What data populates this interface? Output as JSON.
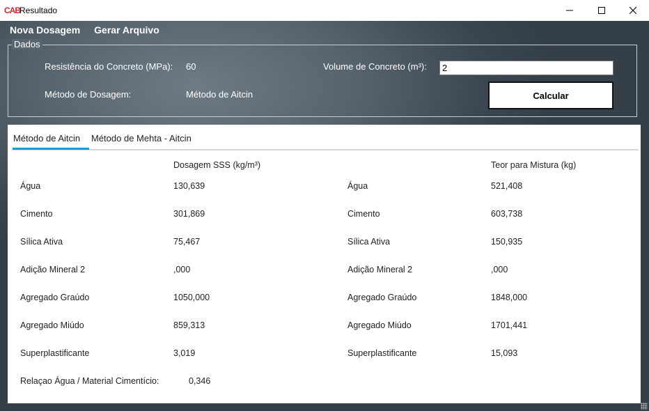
{
  "window": {
    "app_icon_text": "CAB",
    "title": "Resultado"
  },
  "menu": {
    "items": [
      "Nova Dosagem",
      "Gerar Arquivo"
    ]
  },
  "dados": {
    "legend": "Dados",
    "resistencia_label": "Resistência do Concreto (MPa):",
    "resistencia_value": "60",
    "metodo_label": "Método de Dosagem:",
    "metodo_value": "Método de Aitcin",
    "volume_label": "Volume de Concreto (m³):",
    "volume_value": "2",
    "calcular_label": "Calcular"
  },
  "tabs": [
    "Método de Aitcin",
    "Método de Mehta - Aitcin"
  ],
  "results": {
    "col1_header": "Dosagem SSS (kg/m³)",
    "col2_header": "Teor para Mistura (kg)",
    "rows": [
      {
        "label": "Água",
        "sss": "130,639",
        "mix": "521,408"
      },
      {
        "label": "Cimento",
        "sss": "301,869",
        "mix": "603,738"
      },
      {
        "label": "Sílica Ativa",
        "sss": "75,467",
        "mix": "150,935"
      },
      {
        "label": "Adição Mineral 2",
        "sss": ",000",
        "mix": ",000"
      },
      {
        "label": "Agregado Graúdo",
        "sss": "1050,000",
        "mix": "1848,000"
      },
      {
        "label": "Agregado Miúdo",
        "sss": "859,313",
        "mix": "1701,441"
      },
      {
        "label": "Superplastificante",
        "sss": "3,019",
        "mix": "15,093"
      }
    ],
    "relacao_label": "Relaçao Água / Material Cimentício:",
    "relacao_value": "0,346"
  }
}
